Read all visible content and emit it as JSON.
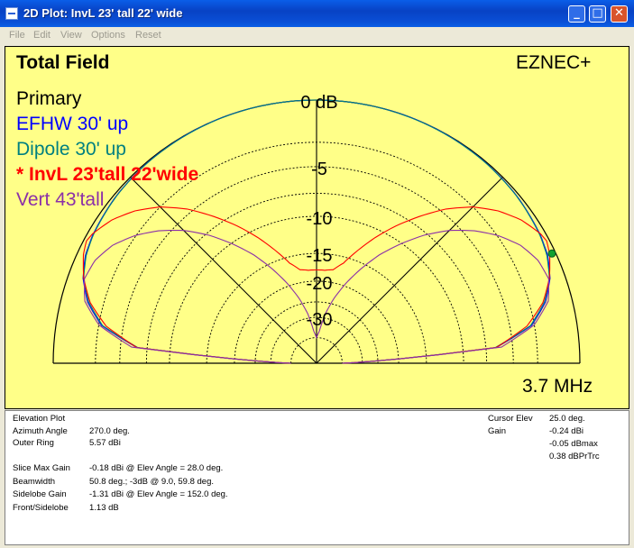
{
  "window": {
    "title": "2D Plot: InvL 23' tall 22' wide",
    "minimize": "0",
    "maximize": "1",
    "close": "r"
  },
  "menu": [
    "File",
    "Edit",
    "View",
    "Options",
    "Reset"
  ],
  "plot": {
    "title": "Total Field",
    "brand": "EZNEC+",
    "frequency": "3.7 MHz",
    "bg_color": "#ffff88"
  },
  "chart_data": {
    "type": "polar",
    "title": "Total Field",
    "scale": "ARRL log",
    "ring_labels": [
      "0 dB",
      "-5",
      "-10",
      "-15",
      "-20",
      "-30"
    ],
    "ring_values_db": [
      0,
      -5,
      -10,
      -15,
      -20,
      -30
    ],
    "ring_grid_db": [
      -3,
      -5,
      -7.5,
      -10,
      -15,
      -20,
      -25,
      -30,
      -40
    ],
    "legend": [
      {
        "name": "Primary",
        "color": "#000000"
      },
      {
        "name": "EFHW 30' up",
        "color": "#0000ff"
      },
      {
        "name": "Dipole 30' up",
        "color": "#008080"
      },
      {
        "name": "* InvL 23'tall 22'wide",
        "color": "#ff0000"
      },
      {
        "name": "Vert 43'tall",
        "color": "#8b30a8"
      }
    ],
    "series": [
      {
        "name": "EFHW 30' up",
        "color": "#0000ff",
        "elev_deg": [
          0,
          5,
          10,
          15,
          20,
          25,
          30,
          40,
          50,
          60,
          70,
          80,
          90
        ],
        "gain_db": [
          -40,
          -6.5,
          -3.2,
          -1.8,
          -1.0,
          -0.55,
          -0.35,
          -0.15,
          -0.06,
          -0.02,
          0,
          0,
          0
        ]
      },
      {
        "name": "Dipole 30' up",
        "color": "#008080",
        "elev_deg": [
          0,
          5,
          10,
          15,
          20,
          25,
          30,
          40,
          50,
          60,
          70,
          80,
          90
        ],
        "gain_db": [
          -40,
          -6.6,
          -3.3,
          -1.9,
          -1.05,
          -0.6,
          -0.38,
          -0.17,
          -0.07,
          -0.03,
          -0.01,
          0,
          0
        ]
      },
      {
        "name": "* InvL 23'tall 22'wide",
        "color": "#ff0000",
        "elev_deg": [
          0,
          5,
          10,
          15,
          20,
          25,
          28,
          30,
          35,
          40,
          45,
          50,
          55,
          60,
          65,
          70,
          75,
          80,
          85,
          90
        ],
        "gain_db": [
          -40,
          -6.5,
          -3.6,
          -2.0,
          -1.05,
          -0.4,
          -0.18,
          -0.3,
          -0.9,
          -1.8,
          -3.0,
          -4.6,
          -6.6,
          -8.7,
          -11.0,
          -13.5,
          -16.0,
          -17.5,
          -17.8,
          -17.8
        ]
      },
      {
        "name": "Vert 43'tall",
        "color": "#8b30a8",
        "elev_deg": [
          0,
          5,
          10,
          15,
          20,
          25,
          30,
          35,
          40,
          45,
          50,
          55,
          60,
          65,
          70,
          75,
          80,
          85,
          90
        ],
        "gain_db": [
          -40,
          -6.0,
          -3.0,
          -1.6,
          -1.1,
          -1.3,
          -1.9,
          -2.9,
          -4.2,
          -5.8,
          -7.8,
          -10.2,
          -12.8,
          -16.0,
          -19.5,
          -23.5,
          -28.5,
          -36,
          -40
        ]
      }
    ],
    "cursor": {
      "elev_deg": 25.0,
      "gain_db": -0.24,
      "color": "#10a030"
    },
    "frequency": "3.7 MHz"
  },
  "info": {
    "left_rows": [
      {
        "label": "Elevation Plot",
        "value": ""
      },
      {
        "label": "Azimuth Angle",
        "value": "270.0 deg."
      },
      {
        "label": "Outer Ring",
        "value": "5.57 dBi"
      },
      {
        "label": "Slice Max Gain",
        "value": "-0.18 dBi @ Elev Angle = 28.0 deg."
      },
      {
        "label": "Beamwidth",
        "value": "50.8 deg.; -3dB @ 9.0, 59.8 deg."
      },
      {
        "label": "Sidelobe Gain",
        "value": "-1.31 dBi @ Elev Angle = 152.0 deg."
      },
      {
        "label": "Front/Sidelobe",
        "value": "1.13 dB"
      }
    ],
    "right_rows": [
      {
        "label": "Cursor Elev",
        "value": "25.0 deg."
      },
      {
        "label": "Gain",
        "value": "-0.24 dBi"
      },
      {
        "label": "",
        "value": "-0.05 dBmax"
      },
      {
        "label": "",
        "value": "0.38 dBPrTrc"
      }
    ]
  }
}
